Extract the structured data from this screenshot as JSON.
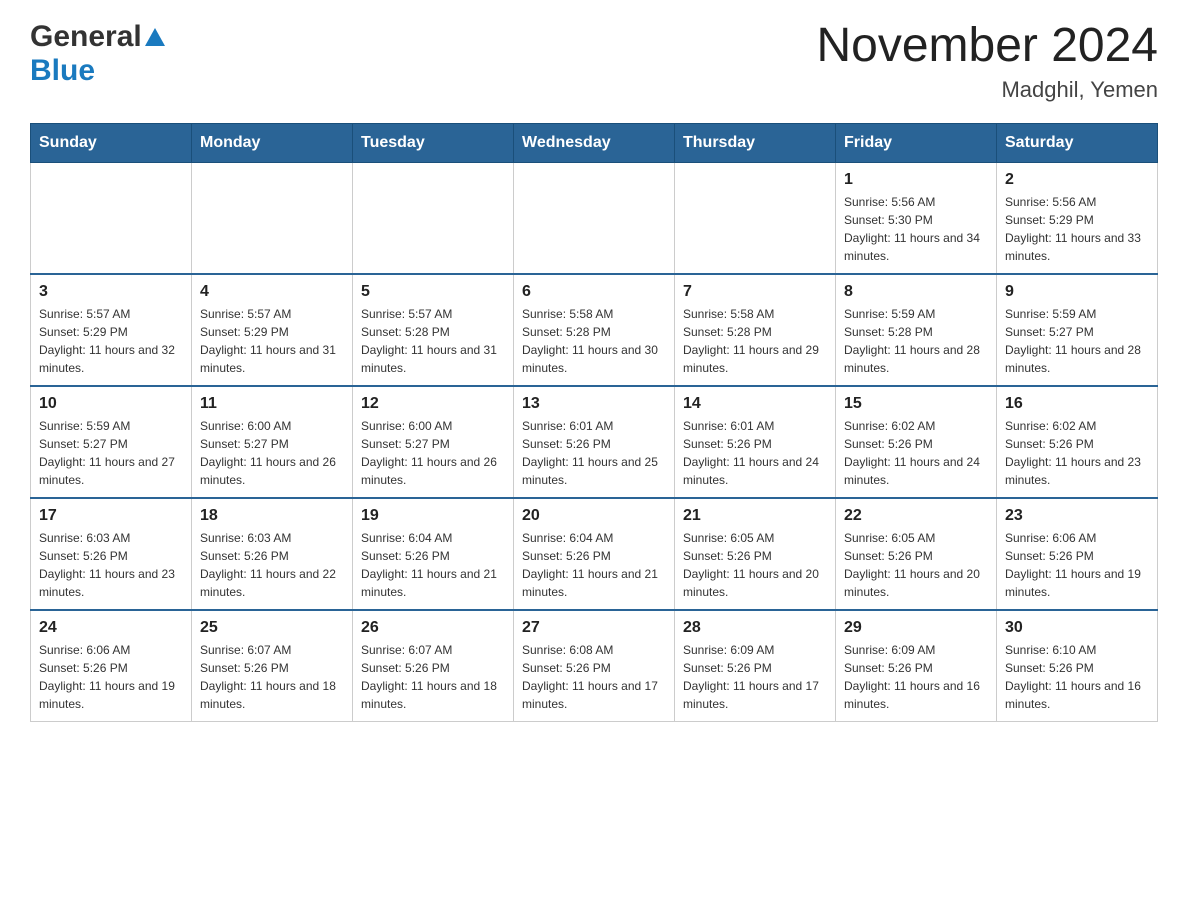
{
  "header": {
    "logo_general": "General",
    "logo_blue": "Blue",
    "month_title": "November 2024",
    "location": "Madghil, Yemen"
  },
  "days_of_week": [
    "Sunday",
    "Monday",
    "Tuesday",
    "Wednesday",
    "Thursday",
    "Friday",
    "Saturday"
  ],
  "weeks": [
    {
      "days": [
        {
          "number": "",
          "sunrise": "",
          "sunset": "",
          "daylight": ""
        },
        {
          "number": "",
          "sunrise": "",
          "sunset": "",
          "daylight": ""
        },
        {
          "number": "",
          "sunrise": "",
          "sunset": "",
          "daylight": ""
        },
        {
          "number": "",
          "sunrise": "",
          "sunset": "",
          "daylight": ""
        },
        {
          "number": "",
          "sunrise": "",
          "sunset": "",
          "daylight": ""
        },
        {
          "number": "1",
          "sunrise": "Sunrise: 5:56 AM",
          "sunset": "Sunset: 5:30 PM",
          "daylight": "Daylight: 11 hours and 34 minutes."
        },
        {
          "number": "2",
          "sunrise": "Sunrise: 5:56 AM",
          "sunset": "Sunset: 5:29 PM",
          "daylight": "Daylight: 11 hours and 33 minutes."
        }
      ]
    },
    {
      "days": [
        {
          "number": "3",
          "sunrise": "Sunrise: 5:57 AM",
          "sunset": "Sunset: 5:29 PM",
          "daylight": "Daylight: 11 hours and 32 minutes."
        },
        {
          "number": "4",
          "sunrise": "Sunrise: 5:57 AM",
          "sunset": "Sunset: 5:29 PM",
          "daylight": "Daylight: 11 hours and 31 minutes."
        },
        {
          "number": "5",
          "sunrise": "Sunrise: 5:57 AM",
          "sunset": "Sunset: 5:28 PM",
          "daylight": "Daylight: 11 hours and 31 minutes."
        },
        {
          "number": "6",
          "sunrise": "Sunrise: 5:58 AM",
          "sunset": "Sunset: 5:28 PM",
          "daylight": "Daylight: 11 hours and 30 minutes."
        },
        {
          "number": "7",
          "sunrise": "Sunrise: 5:58 AM",
          "sunset": "Sunset: 5:28 PM",
          "daylight": "Daylight: 11 hours and 29 minutes."
        },
        {
          "number": "8",
          "sunrise": "Sunrise: 5:59 AM",
          "sunset": "Sunset: 5:28 PM",
          "daylight": "Daylight: 11 hours and 28 minutes."
        },
        {
          "number": "9",
          "sunrise": "Sunrise: 5:59 AM",
          "sunset": "Sunset: 5:27 PM",
          "daylight": "Daylight: 11 hours and 28 minutes."
        }
      ]
    },
    {
      "days": [
        {
          "number": "10",
          "sunrise": "Sunrise: 5:59 AM",
          "sunset": "Sunset: 5:27 PM",
          "daylight": "Daylight: 11 hours and 27 minutes."
        },
        {
          "number": "11",
          "sunrise": "Sunrise: 6:00 AM",
          "sunset": "Sunset: 5:27 PM",
          "daylight": "Daylight: 11 hours and 26 minutes."
        },
        {
          "number": "12",
          "sunrise": "Sunrise: 6:00 AM",
          "sunset": "Sunset: 5:27 PM",
          "daylight": "Daylight: 11 hours and 26 minutes."
        },
        {
          "number": "13",
          "sunrise": "Sunrise: 6:01 AM",
          "sunset": "Sunset: 5:26 PM",
          "daylight": "Daylight: 11 hours and 25 minutes."
        },
        {
          "number": "14",
          "sunrise": "Sunrise: 6:01 AM",
          "sunset": "Sunset: 5:26 PM",
          "daylight": "Daylight: 11 hours and 24 minutes."
        },
        {
          "number": "15",
          "sunrise": "Sunrise: 6:02 AM",
          "sunset": "Sunset: 5:26 PM",
          "daylight": "Daylight: 11 hours and 24 minutes."
        },
        {
          "number": "16",
          "sunrise": "Sunrise: 6:02 AM",
          "sunset": "Sunset: 5:26 PM",
          "daylight": "Daylight: 11 hours and 23 minutes."
        }
      ]
    },
    {
      "days": [
        {
          "number": "17",
          "sunrise": "Sunrise: 6:03 AM",
          "sunset": "Sunset: 5:26 PM",
          "daylight": "Daylight: 11 hours and 23 minutes."
        },
        {
          "number": "18",
          "sunrise": "Sunrise: 6:03 AM",
          "sunset": "Sunset: 5:26 PM",
          "daylight": "Daylight: 11 hours and 22 minutes."
        },
        {
          "number": "19",
          "sunrise": "Sunrise: 6:04 AM",
          "sunset": "Sunset: 5:26 PM",
          "daylight": "Daylight: 11 hours and 21 minutes."
        },
        {
          "number": "20",
          "sunrise": "Sunrise: 6:04 AM",
          "sunset": "Sunset: 5:26 PM",
          "daylight": "Daylight: 11 hours and 21 minutes."
        },
        {
          "number": "21",
          "sunrise": "Sunrise: 6:05 AM",
          "sunset": "Sunset: 5:26 PM",
          "daylight": "Daylight: 11 hours and 20 minutes."
        },
        {
          "number": "22",
          "sunrise": "Sunrise: 6:05 AM",
          "sunset": "Sunset: 5:26 PM",
          "daylight": "Daylight: 11 hours and 20 minutes."
        },
        {
          "number": "23",
          "sunrise": "Sunrise: 6:06 AM",
          "sunset": "Sunset: 5:26 PM",
          "daylight": "Daylight: 11 hours and 19 minutes."
        }
      ]
    },
    {
      "days": [
        {
          "number": "24",
          "sunrise": "Sunrise: 6:06 AM",
          "sunset": "Sunset: 5:26 PM",
          "daylight": "Daylight: 11 hours and 19 minutes."
        },
        {
          "number": "25",
          "sunrise": "Sunrise: 6:07 AM",
          "sunset": "Sunset: 5:26 PM",
          "daylight": "Daylight: 11 hours and 18 minutes."
        },
        {
          "number": "26",
          "sunrise": "Sunrise: 6:07 AM",
          "sunset": "Sunset: 5:26 PM",
          "daylight": "Daylight: 11 hours and 18 minutes."
        },
        {
          "number": "27",
          "sunrise": "Sunrise: 6:08 AM",
          "sunset": "Sunset: 5:26 PM",
          "daylight": "Daylight: 11 hours and 17 minutes."
        },
        {
          "number": "28",
          "sunrise": "Sunrise: 6:09 AM",
          "sunset": "Sunset: 5:26 PM",
          "daylight": "Daylight: 11 hours and 17 minutes."
        },
        {
          "number": "29",
          "sunrise": "Sunrise: 6:09 AM",
          "sunset": "Sunset: 5:26 PM",
          "daylight": "Daylight: 11 hours and 16 minutes."
        },
        {
          "number": "30",
          "sunrise": "Sunrise: 6:10 AM",
          "sunset": "Sunset: 5:26 PM",
          "daylight": "Daylight: 11 hours and 16 minutes."
        }
      ]
    }
  ]
}
